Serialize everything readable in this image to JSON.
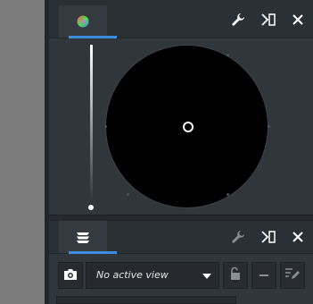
{
  "top_panel": {
    "tab_icon": "color-wheel-icon",
    "buttons": [
      "wrench-icon",
      "float-panel-icon",
      "close-icon"
    ]
  },
  "bottom_panel": {
    "tab_icon": "layers-icon",
    "buttons": [
      "wrench-icon",
      "float-panel-icon",
      "close-icon"
    ],
    "toolbar": {
      "camera_icon": "camera-icon",
      "view_select": {
        "value": "No active view"
      },
      "lock_icon": "unlock-icon",
      "minus_icon": "minus-icon",
      "edit_icon": "edit-list-icon"
    }
  },
  "colors": {
    "accent": "#3a8de0",
    "panel_bg": "#31363b",
    "wheel": "#000000"
  }
}
